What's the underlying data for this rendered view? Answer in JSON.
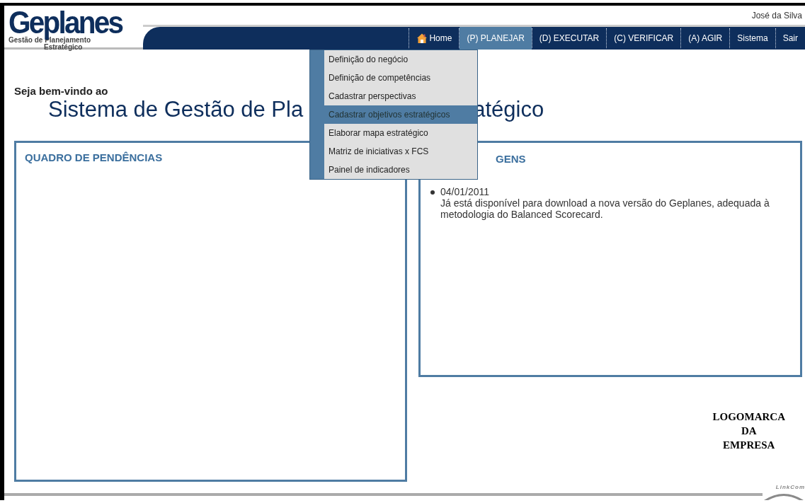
{
  "logo": {
    "name": "Geplanes",
    "subtitle_1": "Gestão de Planejamento",
    "subtitle_2": "Estratégico"
  },
  "user": "José da Silva",
  "nav": [
    {
      "label": "Home",
      "kind": "home",
      "selected": false
    },
    {
      "label": "(P) PLANEJAR",
      "kind": "link",
      "selected": true
    },
    {
      "label": "(D) EXECUTAR",
      "kind": "link",
      "selected": false
    },
    {
      "label": "(C) VERIFICAR",
      "kind": "link",
      "selected": false
    },
    {
      "label": "(A) AGIR",
      "kind": "link",
      "selected": false
    },
    {
      "label": "Sistema",
      "kind": "link",
      "selected": false
    },
    {
      "label": "Sair",
      "kind": "link",
      "selected": false
    }
  ],
  "dropdown": [
    {
      "label": "Definição do negócio",
      "selected": false
    },
    {
      "label": "Definição de competências",
      "selected": false
    },
    {
      "label": "Cadastrar perspectivas",
      "selected": false
    },
    {
      "label": "Cadastrar objetivos estratégicos",
      "selected": true
    },
    {
      "label": "Elaborar mapa estratégico",
      "selected": false
    },
    {
      "label": "Matriz de iniciativas x FCS",
      "selected": false
    },
    {
      "label": "Painel de indicadores",
      "selected": false
    }
  ],
  "welcome": {
    "greeting": "Seja bem-vindo ao",
    "title_left": "Sistema de Gestão de Pla",
    "title_right": "atégico"
  },
  "pendencias": {
    "title": "QUADRO DE PENDÊNCIAS"
  },
  "mensagens": {
    "title": "GENS",
    "items": [
      {
        "date": "04/01/2011",
        "text": "Já está disponível para download a nova versão do Geplanes, adequada à metodologia do Balanced Scorecard."
      }
    ]
  },
  "company_logo": {
    "line_1": "LOGOMARCA",
    "line_2": "DA",
    "line_3": "EMPRESA"
  },
  "footer": {
    "brand": "LinkCom"
  }
}
